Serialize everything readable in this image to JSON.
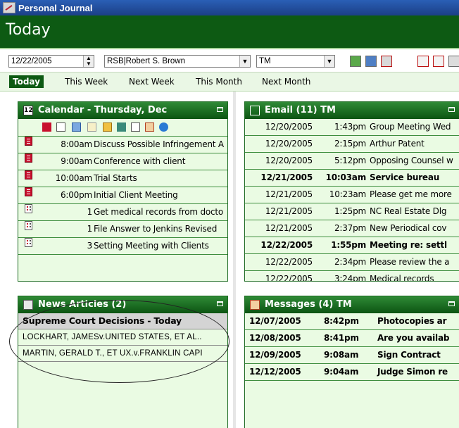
{
  "window": {
    "title": "Personal Journal"
  },
  "header": {
    "title": "Today"
  },
  "toolbar": {
    "date_value": "12/22/2005",
    "user_value": "RSB|Robert S. Brown",
    "filter_value": "TM"
  },
  "nav": {
    "tabs": [
      "Today",
      "This Week",
      "Next Week",
      "This Month",
      "Next Month"
    ],
    "active": "Today"
  },
  "calendar": {
    "title": "Calendar - Thursday, Dec",
    "header_date_number": "12",
    "items": [
      {
        "type": "appointment",
        "time": "8:00am",
        "text": "Discuss Possible Infringement A"
      },
      {
        "type": "appointment",
        "time": "9:00am",
        "text": "Conference with client"
      },
      {
        "type": "appointment",
        "time": "10:00am",
        "text": "Trial Starts"
      },
      {
        "type": "appointment",
        "time": "6:00pm",
        "text": "Initial Client Meeting"
      },
      {
        "type": "task",
        "time": "1",
        "text": "Get medical records from docto"
      },
      {
        "type": "task",
        "time": "1",
        "text": "File Answer to Jenkins Revised"
      },
      {
        "type": "task",
        "time": "3",
        "text": "Setting Meeting with Clients"
      }
    ]
  },
  "email": {
    "title": "Email (11) TM",
    "rows": [
      {
        "date": "12/20/2005",
        "time": "1:43pm",
        "subject": "Group Meeting Wed",
        "bold": false
      },
      {
        "date": "12/20/2005",
        "time": "2:15pm",
        "subject": "Arthur Patent",
        "bold": false
      },
      {
        "date": "12/20/2005",
        "time": "5:12pm",
        "subject": "Opposing Counsel w",
        "bold": false
      },
      {
        "date": "12/21/2005",
        "time": "10:03am",
        "subject": "Service bureau",
        "bold": true
      },
      {
        "date": "12/21/2005",
        "time": "10:23am",
        "subject": "Please get me more",
        "bold": false
      },
      {
        "date": "12/21/2005",
        "time": "1:25pm",
        "subject": "NC Real Estate Dlg",
        "bold": false
      },
      {
        "date": "12/21/2005",
        "time": "2:37pm",
        "subject": "New Periodical cov",
        "bold": false
      },
      {
        "date": "12/22/2005",
        "time": "1:55pm",
        "subject": "Meeting re: settl",
        "bold": true
      },
      {
        "date": "12/22/2005",
        "time": "2:34pm",
        "subject": "Please review the a",
        "bold": false
      },
      {
        "date": "12/22/2005",
        "time": "3:24pm",
        "subject": "Medical records",
        "bold": false
      }
    ]
  },
  "news": {
    "title": "News Articles (2)",
    "group": "Supreme Court Decisions - Today",
    "rows": [
      "LOCKHART, JAMESv.UNITED STATES, ET AL..",
      "MARTIN, GERALD T., ET UX.v.FRANKLIN CAPI"
    ]
  },
  "messages": {
    "title": "Messages (4) TM",
    "rows": [
      {
        "date": "12/07/2005",
        "time": "8:42pm",
        "subject": "Photocopies ar"
      },
      {
        "date": "12/08/2005",
        "time": "8:41pm",
        "subject": "Are you availab"
      },
      {
        "date": "12/09/2005",
        "time": "9:08am",
        "subject": "Sign Contract"
      },
      {
        "date": "12/12/2005",
        "time": "9:04am",
        "subject": "Judge Simon re"
      }
    ]
  },
  "colors": {
    "header_green": "#0d5a13",
    "panel_bg": "#eafbe3",
    "appointment_red": "#c8102e"
  }
}
